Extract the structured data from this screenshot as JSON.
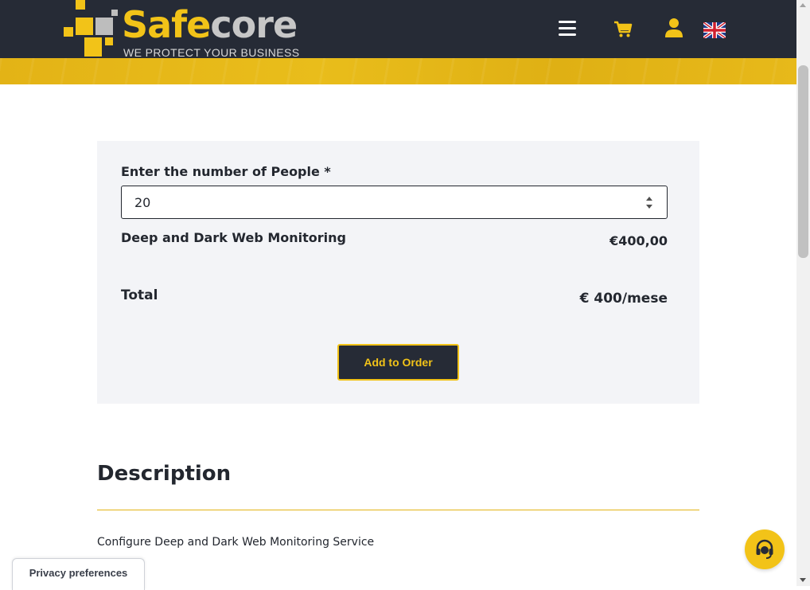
{
  "header": {
    "brand": {
      "part1": "Safe",
      "part2": "core",
      "tagline": "WE PROTECT YOUR BUSINESS"
    },
    "icons": {
      "menu": "menu-icon",
      "cart": "cart-icon",
      "account": "user-icon",
      "language": "uk-flag-icon"
    }
  },
  "form": {
    "people_label": "Enter the number of People *",
    "people_value": "20",
    "service_name": "Deep and Dark Web Monitoring",
    "service_price": "€400,00",
    "total_label": "Total",
    "total_value": "€ 400/mese",
    "add_button": "Add to Order"
  },
  "description": {
    "title": "Description",
    "text": "Configure Deep and Dark Web Monitoring Service"
  },
  "footer": {
    "privacy_label": "Privacy preferences",
    "support_icon": "headset-icon"
  },
  "colors": {
    "accent": "#f2c318",
    "dark": "#262b36",
    "panel": "#f3f4f7"
  }
}
